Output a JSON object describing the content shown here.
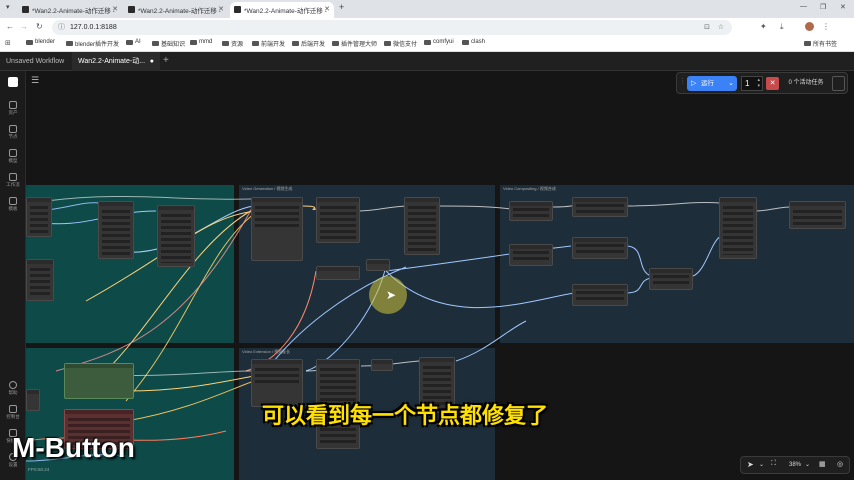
{
  "browser": {
    "tabs": [
      {
        "label": "*Wan2.2-Animate-动作迁移 -"
      },
      {
        "label": "*Wan2.2-Animate-动作迁移 -"
      },
      {
        "label": "*Wan2.2-Animate-动作迁移 -"
      }
    ],
    "new_tab": "+",
    "url": "127.0.0.1:8188",
    "bookmarks": [
      "blender",
      "blender插件开发",
      "AI",
      "基础知识",
      "mmd",
      "资源",
      "前端开发",
      "后端开发",
      "插件管理大师",
      "微信支付",
      "comfyui",
      "clash"
    ],
    "all_bookmarks": "所有书签"
  },
  "app": {
    "tabs": [
      {
        "label": "Unsaved Workflow"
      },
      {
        "label": "Wan2.2-Animate-动..."
      }
    ],
    "add_tab": "+",
    "sidebar": [
      {
        "label": "资产"
      },
      {
        "label": "节点"
      },
      {
        "label": "模型"
      },
      {
        "label": "工作流"
      },
      {
        "label": "模板"
      }
    ],
    "sidebar_bottom": [
      {
        "label": "帮助"
      },
      {
        "label": "控制台"
      },
      {
        "label": "快捷键"
      },
      {
        "label": "设置"
      }
    ],
    "toolbar": {
      "run_label": "运行",
      "batch_count": "1",
      "stop_label": "✕",
      "queue_label": "0 个活动任务"
    },
    "zoom": "38%",
    "groups": [
      {
        "title": "Video Generation / 视频生成"
      },
      {
        "title": "Video Compositing / 视频合成"
      },
      {
        "title": "Video Extension / 视频延长"
      }
    ],
    "fps": "FPS:60.24"
  },
  "overlay": {
    "subtitle": "可以看到每一个节点都修复了",
    "key_caption": "M-Button"
  },
  "colors": {
    "run_blue": "#3b82f6",
    "group_teal": "#0d4a48",
    "group_slate": "#1e2d3a",
    "subtitle_yellow": "#ffe000"
  }
}
